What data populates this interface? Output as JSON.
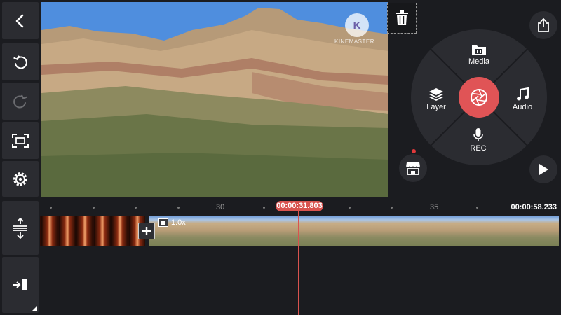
{
  "left_toolbar": {
    "back_icon": "chevron-left-icon",
    "undo_icon": "undo-icon",
    "redo_icon": "redo-icon",
    "fullscreen_icon": "fullscreen-icon",
    "settings_icon": "gear-icon",
    "timeline_expand_icon": "expand-vertical-icon",
    "exit_icon": "exit-icon"
  },
  "preview": {
    "watermark_text": "KINEMASTER"
  },
  "wheel": {
    "media_label": "Media",
    "layer_label": "Layer",
    "audio_label": "Audio",
    "rec_label": "REC"
  },
  "timeline": {
    "tick_labels": [
      "30",
      "35"
    ],
    "playhead_time": "00:00:31.803",
    "total_time": "00:00:58.233",
    "speed_label": "1.0x"
  },
  "colors": {
    "accent": "#e05456",
    "panel": "#2b2c31",
    "background": "#1b1c20"
  }
}
